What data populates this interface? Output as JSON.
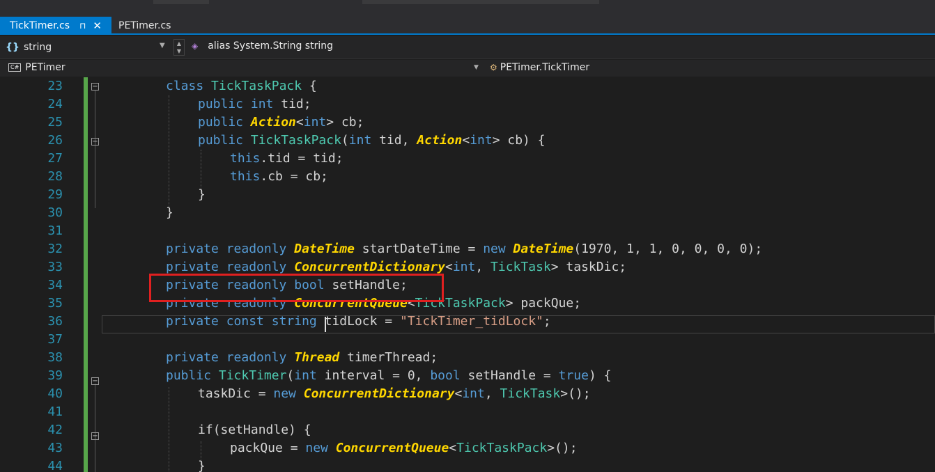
{
  "tabs": [
    {
      "label": "TickTimer.cs",
      "pin": "⊓",
      "close": "✕"
    },
    {
      "label": "PETimer.cs"
    }
  ],
  "navbar1": {
    "left_label": "string",
    "right_label": "alias System.String string"
  },
  "navbar2": {
    "left_icon": "C#",
    "left_label": "PETimer",
    "right_label": "PETimer.TickTimer"
  },
  "lines": [
    {
      "n": "23"
    },
    {
      "n": "24"
    },
    {
      "n": "25"
    },
    {
      "n": "26"
    },
    {
      "n": "27"
    },
    {
      "n": "28"
    },
    {
      "n": "29"
    },
    {
      "n": "30"
    },
    {
      "n": "31"
    },
    {
      "n": "32"
    },
    {
      "n": "33"
    },
    {
      "n": "34"
    },
    {
      "n": "35"
    },
    {
      "n": "36"
    },
    {
      "n": "37"
    },
    {
      "n": "38"
    },
    {
      "n": "39"
    },
    {
      "n": "40"
    },
    {
      "n": "41"
    },
    {
      "n": "42"
    },
    {
      "n": "43"
    },
    {
      "n": "44"
    }
  ],
  "code": {
    "l23": [
      "class",
      "TickTaskPack",
      "{"
    ],
    "l24": [
      "public",
      "int",
      "tid;"
    ],
    "l25": [
      "public",
      "Action",
      "<",
      "int",
      "> cb;"
    ],
    "l26": [
      "public",
      "TickTaskPack",
      "(",
      "int",
      " tid, ",
      "Action",
      "<",
      "int",
      "> cb) {"
    ],
    "l27": [
      "this",
      ".tid = tid;"
    ],
    "l28": [
      "this",
      ".cb = cb;"
    ],
    "l29": [
      "}"
    ],
    "l30": [
      "}"
    ],
    "l32": [
      "private",
      "readonly",
      "DateTime",
      "startDateTime = ",
      "new",
      "DateTime",
      "(1970, 1, 1, 0, 0, 0, 0);"
    ],
    "l33": [
      "private",
      "readonly",
      "ConcurrentDictionary",
      "<",
      "int",
      ", ",
      "TickTask",
      "> taskDic;"
    ],
    "l34": [
      "private",
      "readonly",
      "bool",
      "setHandle;"
    ],
    "l35": [
      "private",
      "readonly",
      "ConcurrentQueue",
      "<",
      "TickTaskPack",
      "> packQue;"
    ],
    "l36": [
      "private",
      "const",
      "string",
      "tidLock = ",
      "\"TickTimer_tidLock\"",
      ";"
    ],
    "l38": [
      "private",
      "readonly",
      "Thread",
      "timerThread;"
    ],
    "l39": [
      "public",
      "TickTimer",
      "(",
      "int",
      " interval = 0, ",
      "bool",
      " setHandle = ",
      "true",
      ") {"
    ],
    "l40": [
      "taskDic = ",
      "new",
      "ConcurrentDictionary",
      "<",
      "int",
      ", ",
      "TickTask",
      ">();"
    ],
    "l42": [
      "if",
      "(setHandle) {"
    ],
    "l43": [
      "packQue = ",
      "new",
      "ConcurrentQueue",
      "<",
      "TickTaskPack",
      ">();"
    ],
    "l44": [
      "}"
    ]
  },
  "colors": {
    "keyword": "#569cd6",
    "type": "#4ec9b0",
    "italic_type": "#ffd700",
    "string": "#d69d85",
    "line_number": "#2b91af",
    "accent": "#007acc",
    "highlight_box": "#e02020"
  }
}
